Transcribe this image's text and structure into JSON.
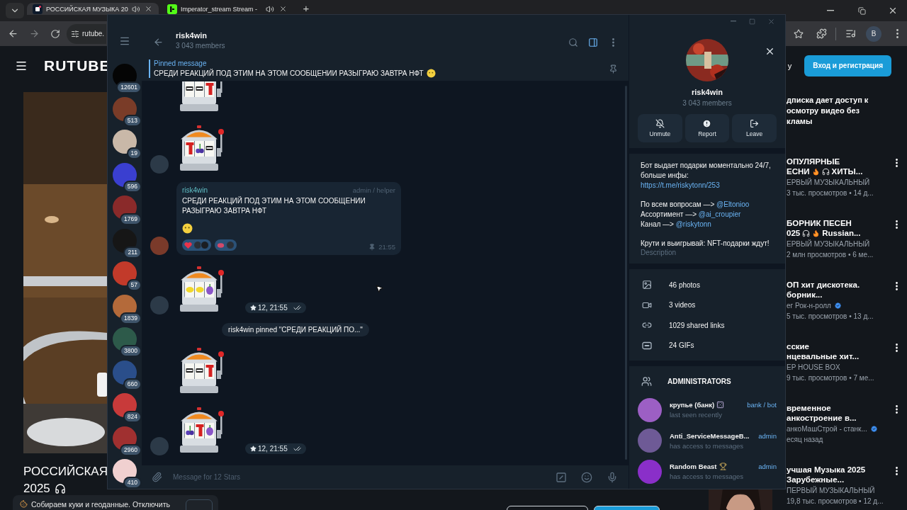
{
  "browser": {
    "tabs": [
      {
        "title": "РОССИЙСКАЯ МУЗЫКА 20",
        "selected": true
      },
      {
        "title": "Imperator_stream Stream -",
        "selected": false
      }
    ],
    "new_tab": "+",
    "address": "rutube.",
    "profile": "B"
  },
  "site": {
    "logo": "RUTUBE",
    "header_text": "у",
    "login": "Вход и регистрация",
    "video": {
      "title": "РОССИЙСКАЯ",
      "subtitle": "2025"
    },
    "promo": [
      "дписка дает доступ к",
      "осмотру видео без",
      "кламы"
    ],
    "videos": [
      {
        "title": [
          [
            "ОПУЛЯРНЫЕ"
          ],
          [
            "ЕСНИ",
            {
              "kind": "fire"
            },
            {
              "kind": "headphones"
            },
            "ХИТЫ..."
          ]
        ],
        "channel": "ЕРВЫЙ МУЗЫКАЛЬНЫЙ",
        "verified": false,
        "meta": "3 тыс. просмотров • 14 д..."
      },
      {
        "title": [
          [
            "БОРНИК ПЕСЕН"
          ],
          [
            "025",
            {
              "kind": "headphones"
            },
            {
              "kind": "fire"
            },
            "Russian..."
          ]
        ],
        "channel": "ЕРВЫЙ МУЗЫКАЛЬНЫЙ",
        "verified": false,
        "meta": "2 млн просмотров • 6 ме..."
      },
      {
        "title": [
          [
            "ОП хит дискотека."
          ],
          [
            "борник..."
          ]
        ],
        "channel": "ег Рок-н-ролл",
        "verified": true,
        "meta": "5 тыс. просмотров • 13 д..."
      },
      {
        "title": [
          [
            "сские"
          ],
          [
            "нцевальные хит..."
          ]
        ],
        "channel": "ЕР HOUSE BOX",
        "verified": false,
        "meta": "9 тыс. просмотров • 7 ме..."
      },
      {
        "title": [
          [
            "временное"
          ],
          [
            "анкостроение в..."
          ]
        ],
        "channel": "анкоМашСтрой - станк...",
        "verified": true,
        "meta": "есяц назад"
      },
      {
        "title": [
          [
            "учшая Музыка 2025"
          ],
          [
            "Зарубежные..."
          ]
        ],
        "channel": "ПЕРВЫЙ МУЗЫКАЛЬНЫЙ",
        "verified": false,
        "meta": "19,8 тыс. просмотров • 12 д..."
      }
    ],
    "cookie": {
      "text": "Собираем куки и геоданные. Отключить"
    }
  },
  "telegram": {
    "folders": [
      {
        "count": "12601",
        "color": "#050505"
      },
      {
        "count": "513",
        "color": "#7a3c28"
      },
      {
        "count": "19",
        "color": "#c9b8a8"
      },
      {
        "count": "596",
        "color": "#3a3fd0"
      },
      {
        "count": "1769",
        "color": "#8a2a2a"
      },
      {
        "count": "211",
        "color": "#161616"
      },
      {
        "count": "57",
        "color": "#c23a2a"
      },
      {
        "count": "1839",
        "color": "#b46a3a"
      },
      {
        "count": "3800",
        "color": "#2d5a4a"
      },
      {
        "count": "660",
        "color": "#2a4e8a"
      },
      {
        "count": "824",
        "color": "#c83a3a"
      },
      {
        "count": "2960",
        "color": "#a03030"
      },
      {
        "count": "410",
        "color": "#f0d0d0"
      }
    ],
    "chat": {
      "title": "risk4win",
      "subtitle": "3 043 members",
      "pinned": {
        "label": "Pinned message",
        "text": "СРЕДИ РЕАКЦИЙ ПОД ЭТИМ НА ЭТОМ СООБЩЕНИИ РАЗЫГРАЮ ЗАВТРА НФТ"
      },
      "messages": [
        {
          "kind": "dice",
          "reels": [
            {
              "kind": "bar"
            },
            {
              "kind": "bar"
            },
            {
              "kind": "seven"
            }
          ],
          "avatar": false
        },
        {
          "kind": "dice",
          "reels": [
            {
              "kind": "seven"
            },
            {
              "kind": "cherry"
            },
            {
              "kind": "bar"
            }
          ],
          "avatar": true,
          "color": "#2c3a48"
        },
        {
          "kind": "text",
          "author": "risk4win",
          "role": "admin / helper",
          "text": "СРЕДИ РЕАКЦИЙ ПОД ЭТИМ НА ЭТОМ СООБЩЕНИИ РАЗЫГРАЮ ЗАВТРА НФТ",
          "reactions": [
            {
              "kind": "heart",
              "avatars": [
                {
                  "color": "#2a2f36"
                },
                {
                  "color": "#1a1d22"
                }
              ]
            },
            {
              "kind": "kiss",
              "avatars": [
                {
                  "color": "#2a2f36"
                }
              ]
            }
          ],
          "pinned": true,
          "time": "21:55",
          "avatar": true,
          "color": "#7a3a2a"
        },
        {
          "kind": "dice",
          "reels": [
            {
              "kind": "lemon"
            },
            {
              "kind": "lemon"
            },
            {
              "kind": "plum"
            }
          ],
          "avatar": true,
          "color": "#2c3a48",
          "meta": "12, 21:55",
          "read": true
        },
        {
          "kind": "service",
          "text": "risk4win pinned \"СРЕДИ РЕАКЦИЙ ПО...\""
        },
        {
          "kind": "dice",
          "reels": [
            {
              "kind": "bar"
            },
            {
              "kind": "bar"
            },
            {
              "kind": "seven"
            }
          ],
          "avatar": false
        },
        {
          "kind": "dice",
          "reels": [
            {
              "kind": "cherry"
            },
            {
              "kind": "seven"
            },
            {
              "kind": "plum"
            }
          ],
          "avatar": true,
          "color": "#2c3a48",
          "meta": "12, 21:55",
          "read": true
        }
      ],
      "input_placeholder": "Message for 12 Stars"
    },
    "profile": {
      "name": "risk4win",
      "members": "3 043 members",
      "actions": [
        {
          "kind": "unmute",
          "label": "Unmute"
        },
        {
          "kind": "report",
          "label": "Report"
        },
        {
          "kind": "leave",
          "label": "Leave"
        }
      ],
      "description": [
        [
          {
            "text": "Бот выдает подарки моментально 24/7, больше инфы:"
          },
          {
            "link": "https://t.me/riskytonn/253"
          }
        ],
        [
          {
            "text": "По всем вопросам —>",
            "link": "@Eltonioo"
          },
          {
            "text": "Ассортимент —>",
            "link": "@ai_croupier"
          },
          {
            "text": "Канал —>",
            "link": "@riskytonn"
          }
        ],
        [
          {
            "text": "Крути и выигрывай: NFT-подарки ждут!"
          }
        ]
      ],
      "description_label": "Description",
      "media": [
        {
          "kind": "photos",
          "label": "46 photos"
        },
        {
          "kind": "videos",
          "label": "3 videos"
        },
        {
          "kind": "links",
          "label": "1029 shared links"
        },
        {
          "kind": "gifs",
          "label": "24 GIFs"
        }
      ],
      "admins_title": "ADMINISTRATORS",
      "admins": [
        {
          "name": "крупье (банк)",
          "badge": {
            "kind": "dice"
          },
          "status": "last seen recently",
          "role": "bank / bot",
          "color": "#9c5fc4"
        },
        {
          "name": "Anti_ServiceMessageB...",
          "status": "has access to messages",
          "role": "admin",
          "color": "#6e5a96"
        },
        {
          "name": "Random Beast",
          "badge": {
            "kind": "trophy"
          },
          "status": "has access to messages",
          "role": "admin",
          "color": "#8a2fc9"
        }
      ]
    }
  }
}
